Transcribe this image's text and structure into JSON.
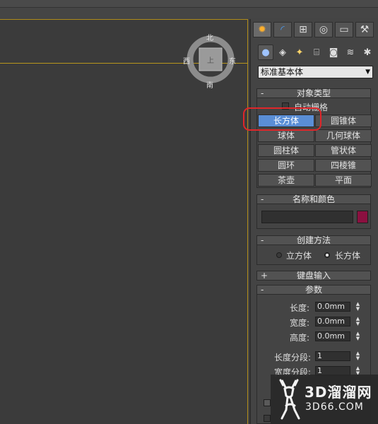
{
  "viewcube": {
    "north": "北",
    "south": "南",
    "east": "东",
    "west": "西",
    "face": "上"
  },
  "command_tabs": [
    {
      "name": "create",
      "icon": "sun-icon",
      "glyph": "✹"
    },
    {
      "name": "modify",
      "icon": "curve-icon",
      "glyph": "◜"
    },
    {
      "name": "hierarchy",
      "icon": "hierarchy-icon",
      "glyph": "⊞"
    },
    {
      "name": "motion",
      "icon": "motion-icon",
      "glyph": "◎"
    },
    {
      "name": "display",
      "icon": "display-icon",
      "glyph": "▭"
    },
    {
      "name": "utilities",
      "icon": "hammer-icon",
      "glyph": "⚒"
    }
  ],
  "categories": [
    {
      "name": "geometry",
      "glyph": "●"
    },
    {
      "name": "shapes",
      "glyph": "◈"
    },
    {
      "name": "lights",
      "glyph": "✦"
    },
    {
      "name": "cameras",
      "glyph": "⌸"
    },
    {
      "name": "helpers",
      "glyph": "◙"
    },
    {
      "name": "space-warps",
      "glyph": "≋"
    },
    {
      "name": "systems",
      "glyph": "✱"
    }
  ],
  "primitive_type": "标准基本体",
  "object_type": {
    "title": "对象类型",
    "collapse_sign": "-",
    "autogrid_label": "自动栅格",
    "buttons": [
      "长方体",
      "圆锥体",
      "球体",
      "几何球体",
      "圆柱体",
      "管状体",
      "圆环",
      "四棱锥",
      "茶壶",
      "平面"
    ],
    "selected": "长方体"
  },
  "name_color": {
    "title": "名称和颜色",
    "collapse_sign": "-",
    "name_value": "",
    "color": "#8b1040"
  },
  "creation_method": {
    "title": "创建方法",
    "collapse_sign": "-",
    "options": [
      "立方体",
      "长方体"
    ],
    "selected": "长方体"
  },
  "keyboard_entry": {
    "title": "键盘输入",
    "collapse_sign": "+"
  },
  "parameters": {
    "title": "参数",
    "collapse_sign": "-",
    "length_label": "长度:",
    "length_value": "0.0mm",
    "width_label": "宽度:",
    "width_value": "0.0mm",
    "height_label": "高度:",
    "height_value": "0.0mm",
    "length_seg_label": "长度分段:",
    "length_seg_value": "1",
    "width_seg_label": "宽度分段:",
    "width_seg_value": "1"
  },
  "watermark": {
    "title": "3D溜溜网",
    "subtitle": "3D66.COM"
  }
}
